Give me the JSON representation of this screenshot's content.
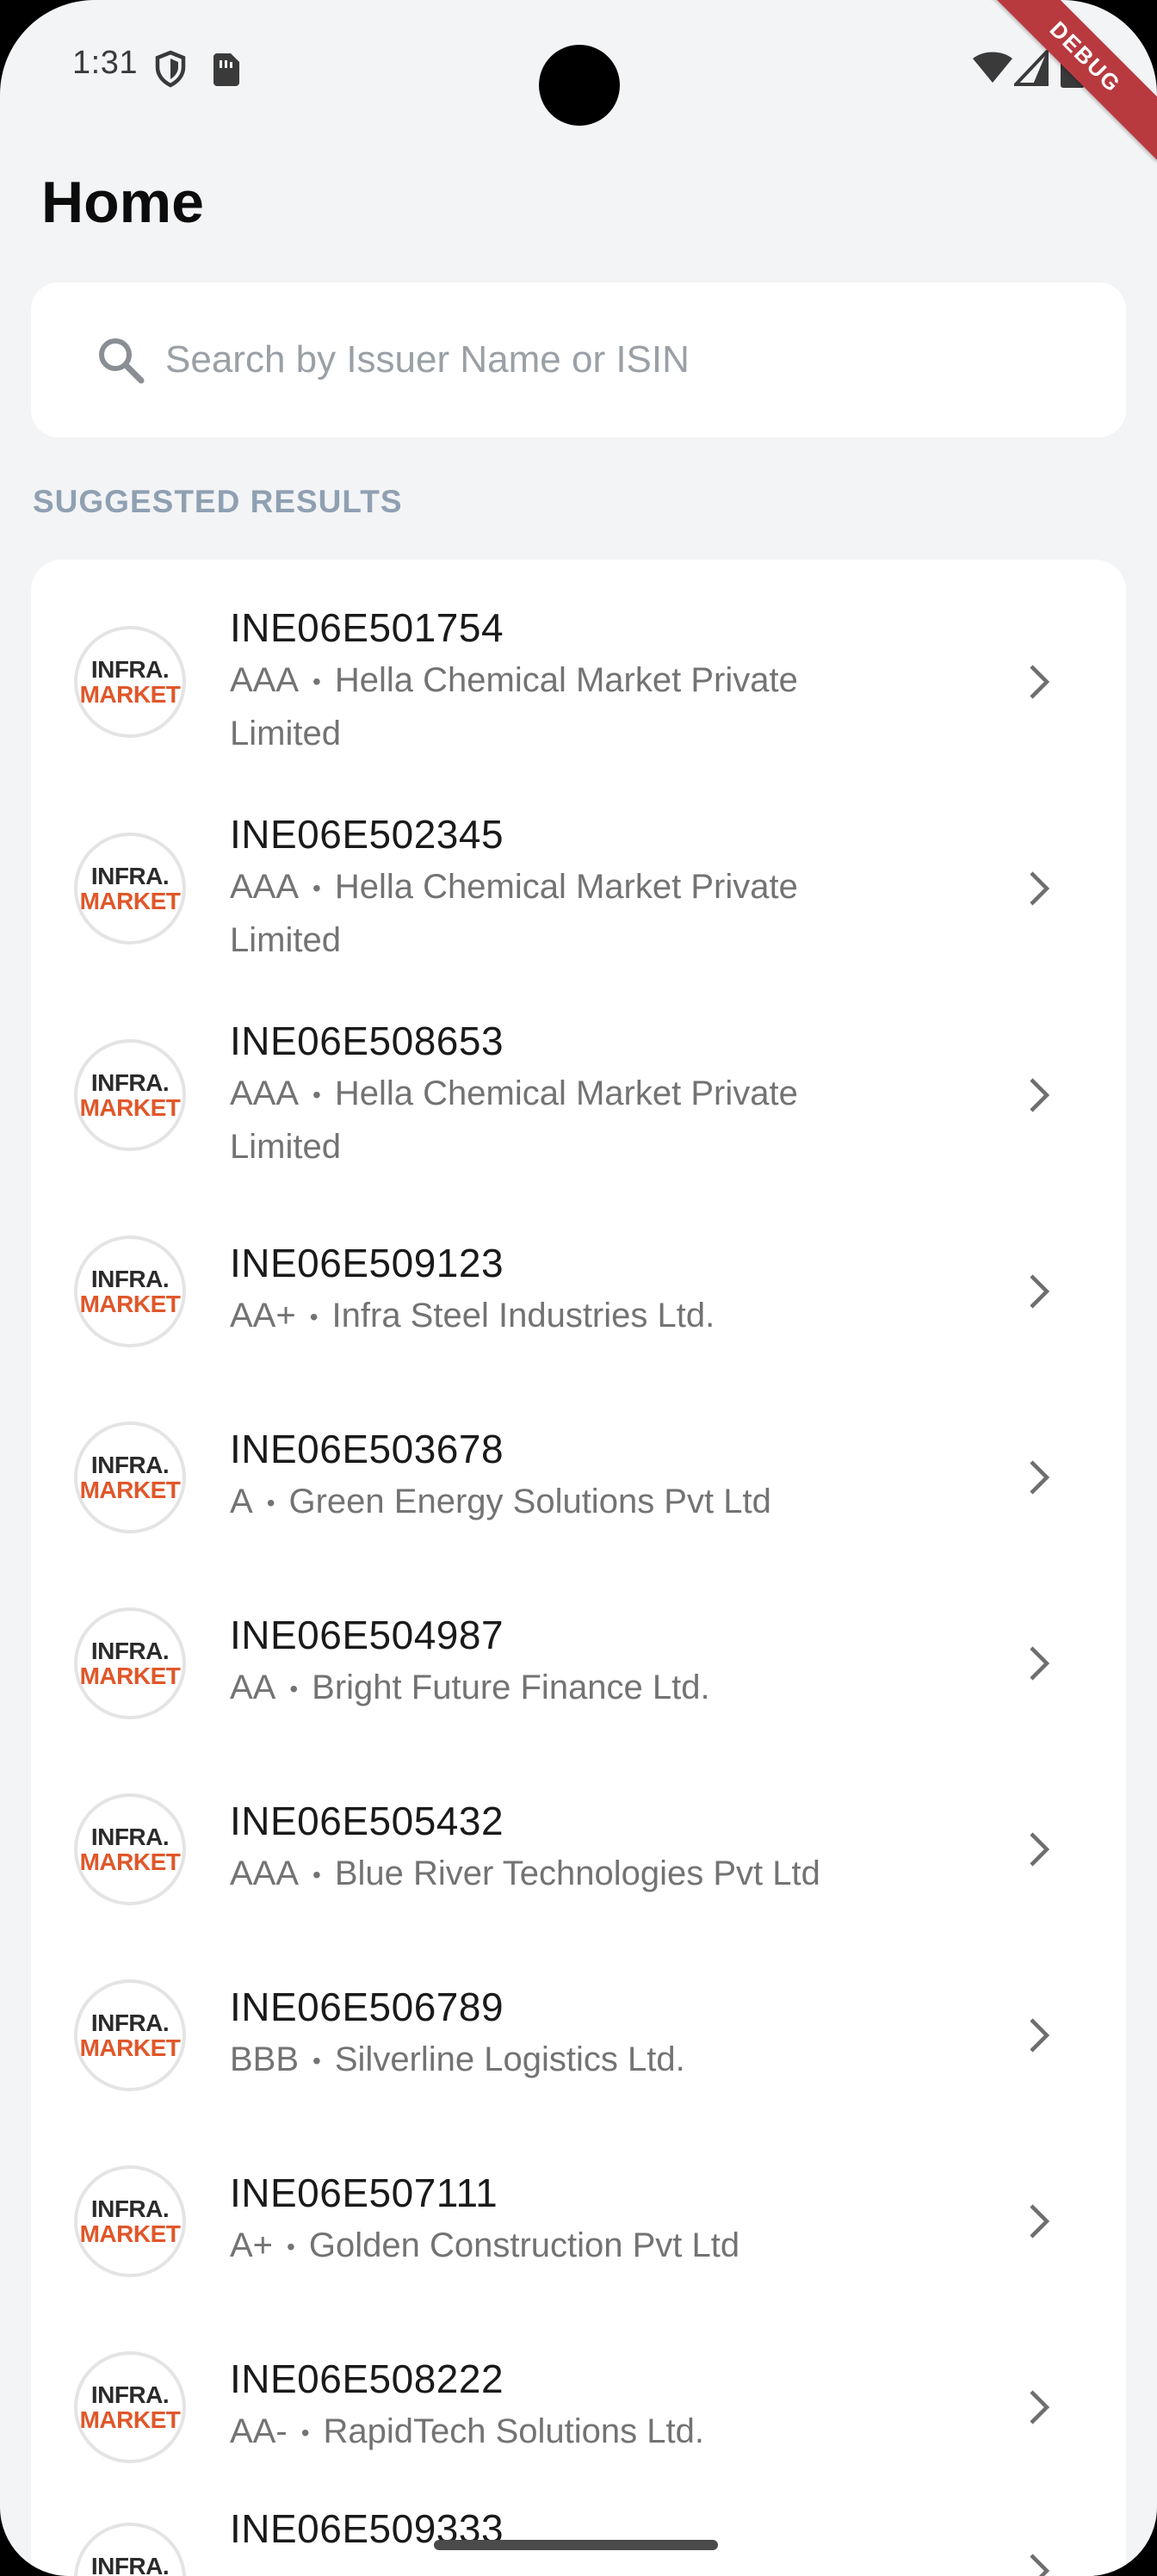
{
  "status_bar": {
    "time": "1:31",
    "icons": [
      "shield-icon",
      "sim-card-icon",
      "wifi-icon",
      "cell-signal-icon",
      "battery-icon"
    ],
    "debug_label": "DEBUG"
  },
  "header": {
    "title": "Home"
  },
  "search": {
    "placeholder": "Search by Issuer Name or ISIN",
    "value": ""
  },
  "section": {
    "label": "SUGGESTED RESULTS"
  },
  "logo": {
    "line1": "INFRA.",
    "line2": "MARKET",
    "accent": "#e0572a"
  },
  "results": [
    {
      "isin": "INE06E501754",
      "rating": "AAA",
      "issuer": "Hella Chemical Market Private",
      "issuer_cont": "Limited"
    },
    {
      "isin": "INE06E502345",
      "rating": "AAA",
      "issuer": "Hella Chemical Market Private",
      "issuer_cont": "Limited"
    },
    {
      "isin": "INE06E508653",
      "rating": "AAA",
      "issuer": "Hella Chemical Market Private",
      "issuer_cont": "Limited"
    },
    {
      "isin": "INE06E509123",
      "rating": "AA+",
      "issuer": "Infra Steel Industries Ltd."
    },
    {
      "isin": "INE06E503678",
      "rating": "A",
      "issuer": "Green Energy Solutions Pvt Ltd"
    },
    {
      "isin": "INE06E504987",
      "rating": "AA",
      "issuer": "Bright Future Finance Ltd."
    },
    {
      "isin": "INE06E505432",
      "rating": "AAA",
      "issuer": "Blue River Technologies Pvt Ltd"
    },
    {
      "isin": "INE06E506789",
      "rating": "BBB",
      "issuer": "Silverline Logistics Ltd."
    },
    {
      "isin": "INE06E507111",
      "rating": "A+",
      "issuer": "Golden Construction Pvt Ltd"
    },
    {
      "isin": "INE06E508222",
      "rating": "AA-",
      "issuer": "RapidTech Solutions Ltd."
    },
    {
      "isin": "INE06E509333",
      "rating": "",
      "issuer": ""
    }
  ]
}
